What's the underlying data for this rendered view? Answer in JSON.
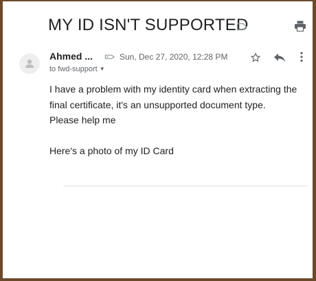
{
  "email": {
    "subject": "MY ID ISN'T SUPPORTED",
    "sender_name": "Ahmed ...",
    "date": "Sun, Dec 27, 2020, 12:28 PM",
    "recipient": "to fwd-support",
    "body_lines": [
      "I have a problem with my identity card when extracting the final certificate, it's an unsupported document type.",
      "Please help me",
      "",
      "Here's a photo of my ID Card"
    ]
  },
  "icons": {
    "label": "label-icon",
    "print": "print-icon",
    "avatar": "person-icon",
    "tag": "tag-icon",
    "star": "star-icon",
    "reply": "reply-icon",
    "more": "more-vertical-icon",
    "caret": "chevron-down-icon"
  },
  "colors": {
    "text": "#202124",
    "secondary_text": "#5f6368",
    "background": "#ffffff",
    "outer_background": "#6b4a2c"
  }
}
